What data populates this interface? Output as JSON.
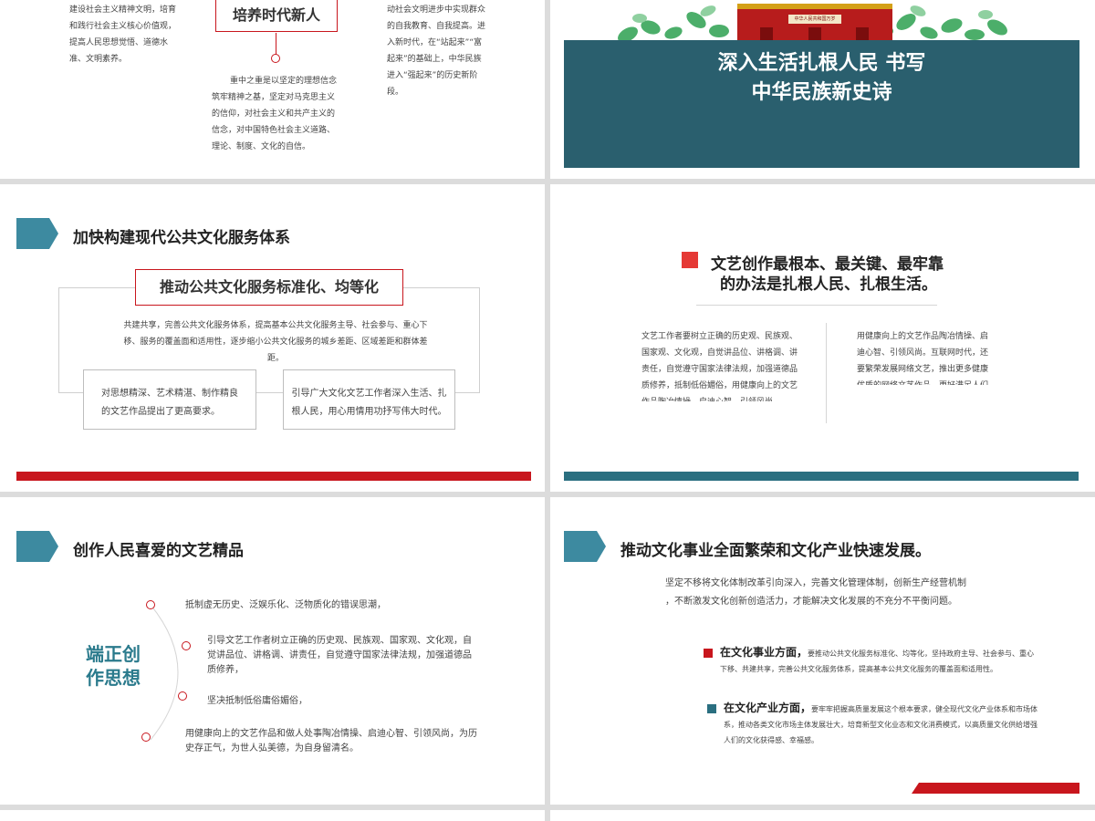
{
  "colors": {
    "red": "#c8161d",
    "teal": "#2a5f6e",
    "chevron": "#3d8aa0"
  },
  "slide1": {
    "left_text": "建设社会主义精神文明，培育和践行社会主义核心价值观，提高人民思想觉悟、道德水准、文明素养。",
    "box_title": "培养时代新人",
    "center_text": "重中之重是以坚定的理想信念筑牢精神之基，坚定对马克思主义的信仰，对社会主义和共产主义的信念，对中国特色社会主义道路、理论、制度、文化的自信。",
    "right_text": "动社会文明进步中实现群众的自我教育、自我提高。进入新时代，在“站起来”“富起来”的基础上，中华民族进入“强起来”的历史新阶段。"
  },
  "slide2": {
    "banner_line1": "深入生活扎根人民 书写",
    "banner_line2": "中华民族新史诗",
    "gate_sign": "中华人民共和国万岁"
  },
  "slide3": {
    "heading": "加快构建现代公共文化服务体系",
    "box_title": "推动公共文化服务标准化、均等化",
    "main_text": "共建共享，完善公共文化服务体系，提高基本公共文化服务主导、社会参与、重心下移、服务的覆盖面和适用性，逐步缩小公共文化服务的城乡差距、区域差距和群体差距。",
    "left_card": "对思想精深、艺术精湛、制作精良的文艺作品提出了更高要求。",
    "right_card": "引导广大文化文艺工作者深入生活、扎根人民，用心用情用功抒写伟大时代。"
  },
  "slide4": {
    "title_line1": "文艺创作最根本、最关键、最牢靠",
    "title_line2": "的办法是扎根人民、扎根生活。",
    "left_text": "文艺工作者要树立正确的历史观、民族观、国家观、文化观，自觉讲品位、讲格调、讲责任，自觉遵守国家法律法规，加强道德品质修养，抵制低俗媚俗，用健康向上的文艺作品陶冶情操、启迪心智、引领风尚。",
    "right_text": "用健康向上的文艺作品陶冶情操、启迪心智、引领风尚。互联网时代，还要繁荣发展网络文艺，推出更多健康优质的网络文艺作品，更好满足人们多元多样的文化需求。"
  },
  "slide5": {
    "heading": "创作人民喜爱的文艺精品",
    "side_title_line1": "端正创",
    "side_title_line2": "作思想",
    "items": [
      "抵制虚无历史、泛娱乐化、泛物质化的错误思潮，",
      "引导文艺工作者树立正确的历史观、民族观、国家观、文化观，自觉讲品位、讲格调、讲责任，自觉遵守国家法律法规，加强道德品质修养，",
      "坚决抵制低俗庸俗媚俗，",
      "用健康向上的文艺作品和做人处事陶冶情操、启迪心智、引领风尚，为历史存正气，为世人弘美德，为自身留清名。"
    ]
  },
  "slide6": {
    "heading": "推动文化事业全面繁荣和文化产业快速发展。",
    "intro_line1": "坚定不移将文化体制改革引向深入，完善文化管理体制，创新生产经营机制",
    "intro_line2": "，不断激发文化创新创造活力，才能解决文化发展的不充分不平衡问题。",
    "point1_title": "在文化事业方面，",
    "point1_text": "要推动公共文化服务标准化、均等化，坚持政府主导、社会参与、重心下移、共建共享，完善公共文化服务体系，提高基本公共文化服务的覆盖面和适用性。",
    "point2_title": "在文化产业方面，",
    "point2_text": "要牢牢把握高质量发展这个根本要求，健全现代文化产业体系和市场体系，推动各类文化市场主体发展壮大，培育新型文化业态和文化消费模式，以高质量文化供给增强人们的文化获得感、幸福感。"
  }
}
